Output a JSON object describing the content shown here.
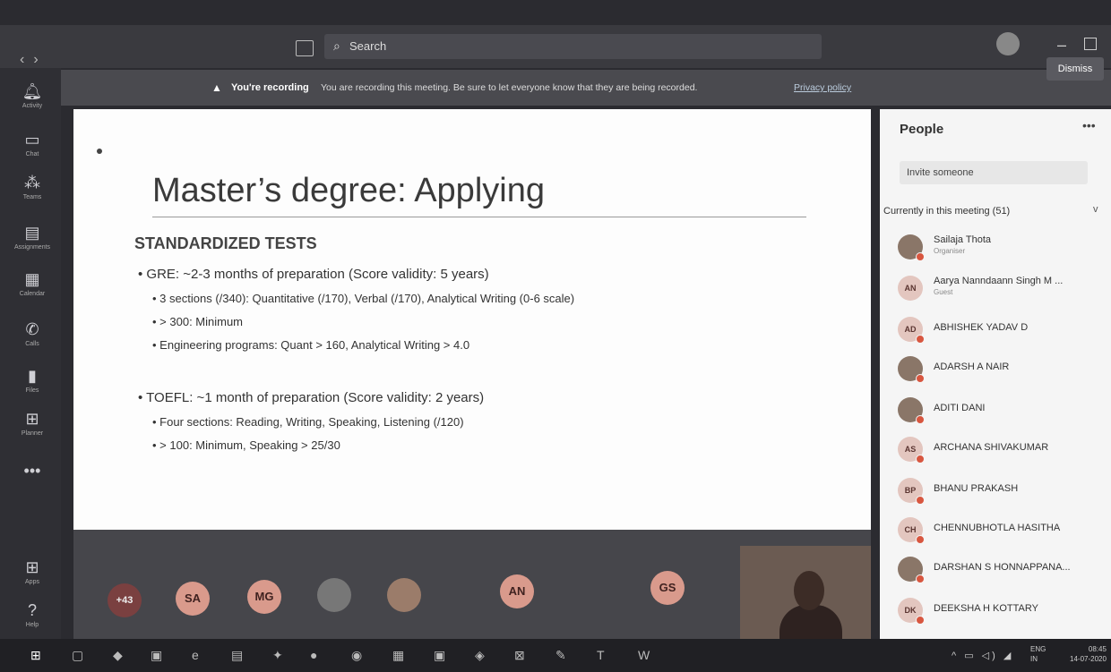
{
  "header": {
    "nav_back": "‹",
    "nav_forward": "›",
    "search_placeholder": "Search"
  },
  "banner": {
    "title": "You're recording",
    "message": "You are recording this meeting. Be sure to let everyone know that they are being recorded.",
    "link": "Privacy policy",
    "dismiss_label": "Dismiss"
  },
  "rail": [
    {
      "label": "Activity",
      "icon": "bell-icon"
    },
    {
      "label": "Chat",
      "icon": "chat-icon"
    },
    {
      "label": "Teams",
      "icon": "teams-icon"
    },
    {
      "label": "Assignments",
      "icon": "assignments-icon"
    },
    {
      "label": "Calendar",
      "icon": "calendar-icon"
    },
    {
      "label": "Calls",
      "icon": "phone-icon"
    },
    {
      "label": "Files",
      "icon": "files-icon"
    },
    {
      "label": "Planner",
      "icon": "planner-icon"
    },
    {
      "label": "Apps",
      "icon": "apps-icon"
    },
    {
      "label": "Help",
      "icon": "help-icon"
    }
  ],
  "slide": {
    "title": "Master’s degree: Applying",
    "section": "STANDARDIZED TESTS",
    "gre": "GRE: ~2-3 months of preparation (Score validity: 5 years)",
    "gre_sub": [
      "3 sections (/340): Quantitative (/170), Verbal (/170), Analytical Writing (0-6 scale)",
      "> 300: Minimum",
      "Engineering programs: Quant > 160, Analytical Writing > 4.0"
    ],
    "toefl": "TOEFL: ~1 month of preparation (Score validity: 2 years)",
    "toefl_sub": [
      "Four sections: Reading, Writing, Speaking, Listening (/120)",
      "> 100: Minimum, Speaking > 25/30"
    ]
  },
  "stage": {
    "overflow_count": "+43",
    "participants": [
      "SA",
      "MG",
      "AN",
      "GS"
    ]
  },
  "people": {
    "title": "People",
    "more": "•••",
    "invite_placeholder": "Invite someone",
    "current_label": "Currently in this meeting (51)",
    "list": [
      {
        "initials": "",
        "name": "Sailaja Thota",
        "role": "Organiser"
      },
      {
        "initials": "AN",
        "name": "Aarya Nanndaann Singh M ...",
        "role": "Guest"
      },
      {
        "initials": "AD",
        "name": "ABHISHEK YADAV D",
        "role": ""
      },
      {
        "initials": "",
        "name": "ADARSH A NAIR",
        "role": ""
      },
      {
        "initials": "",
        "name": "ADITI DANI",
        "role": ""
      },
      {
        "initials": "AS",
        "name": "ARCHANA SHIVAKUMAR",
        "role": ""
      },
      {
        "initials": "BP",
        "name": "BHANU PRAKASH",
        "role": ""
      },
      {
        "initials": "CH",
        "name": "CHENNUBHOTLA HASITHA",
        "role": ""
      },
      {
        "initials": "",
        "name": "DARSHAN S HONNAPPANA...",
        "role": ""
      },
      {
        "initials": "DK",
        "name": "DEEKSHA H KOTTARY",
        "role": ""
      }
    ]
  },
  "taskbar": {
    "lang_top": "ENG",
    "lang_bottom": "IN",
    "time": "08:45",
    "date": "14-07-2020"
  }
}
